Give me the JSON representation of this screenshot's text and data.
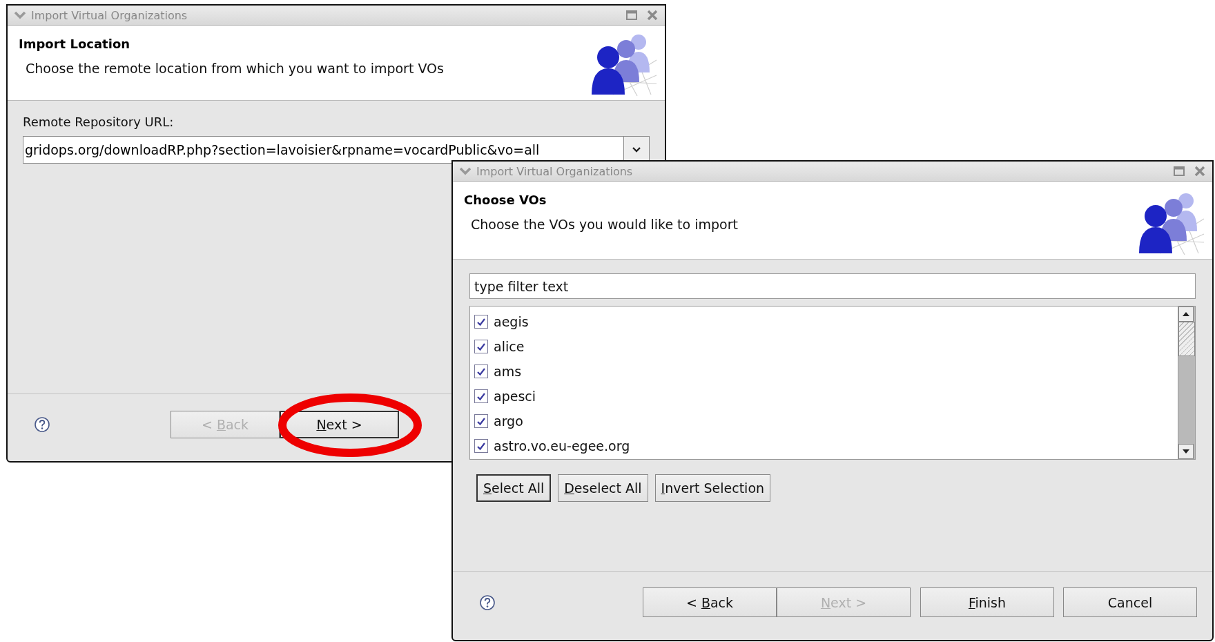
{
  "windows": [
    {
      "kind": "location",
      "title": "Import Virtual Organizations",
      "heading": "Import Location",
      "description": "Choose the remote location from which you want to import VOs",
      "url_label": "Remote Repository URL:",
      "url_value": "gridops.org/downloadRP.php?section=lavoisier&rpname=vocardPublic&vo=all",
      "nav_buttons": [
        {
          "pre": "< ",
          "key": "B",
          "post": "ack",
          "disabled": true,
          "focused": false,
          "highlighted": false
        },
        {
          "key": "N",
          "post": "ext >",
          "disabled": false,
          "focused": true,
          "highlighted": true
        }
      ]
    },
    {
      "kind": "choose",
      "title": "Import Virtual Organizations",
      "heading": "Choose VOs",
      "description": "Choose the VOs you would like to import",
      "filter_value": "type filter text",
      "items": [
        {
          "label": "aegis",
          "checked": true
        },
        {
          "label": "alice",
          "checked": true
        },
        {
          "label": "ams",
          "checked": true
        },
        {
          "label": "apesci",
          "checked": true
        },
        {
          "label": "argo",
          "checked": true
        },
        {
          "label": "astro.vo.eu-egee.org",
          "checked": true
        }
      ],
      "select_buttons": [
        {
          "key": "S",
          "post": "elect All",
          "focused": true
        },
        {
          "key": "D",
          "post": "eselect All",
          "focused": false
        },
        {
          "key": "I",
          "post": "nvert Selection",
          "focused": false
        }
      ],
      "nav_buttons": [
        {
          "pre": "< ",
          "key": "B",
          "post": "ack",
          "disabled": false,
          "focused": false,
          "highlighted": false
        },
        {
          "key": "N",
          "post": "ext >",
          "disabled": true,
          "focused": false,
          "highlighted": false
        },
        {
          "key": "F",
          "post": "inish",
          "disabled": false,
          "focused": false,
          "highlighted": false
        },
        {
          "pre": "Cancel",
          "disabled": false,
          "focused": false,
          "highlighted": false
        }
      ]
    }
  ]
}
